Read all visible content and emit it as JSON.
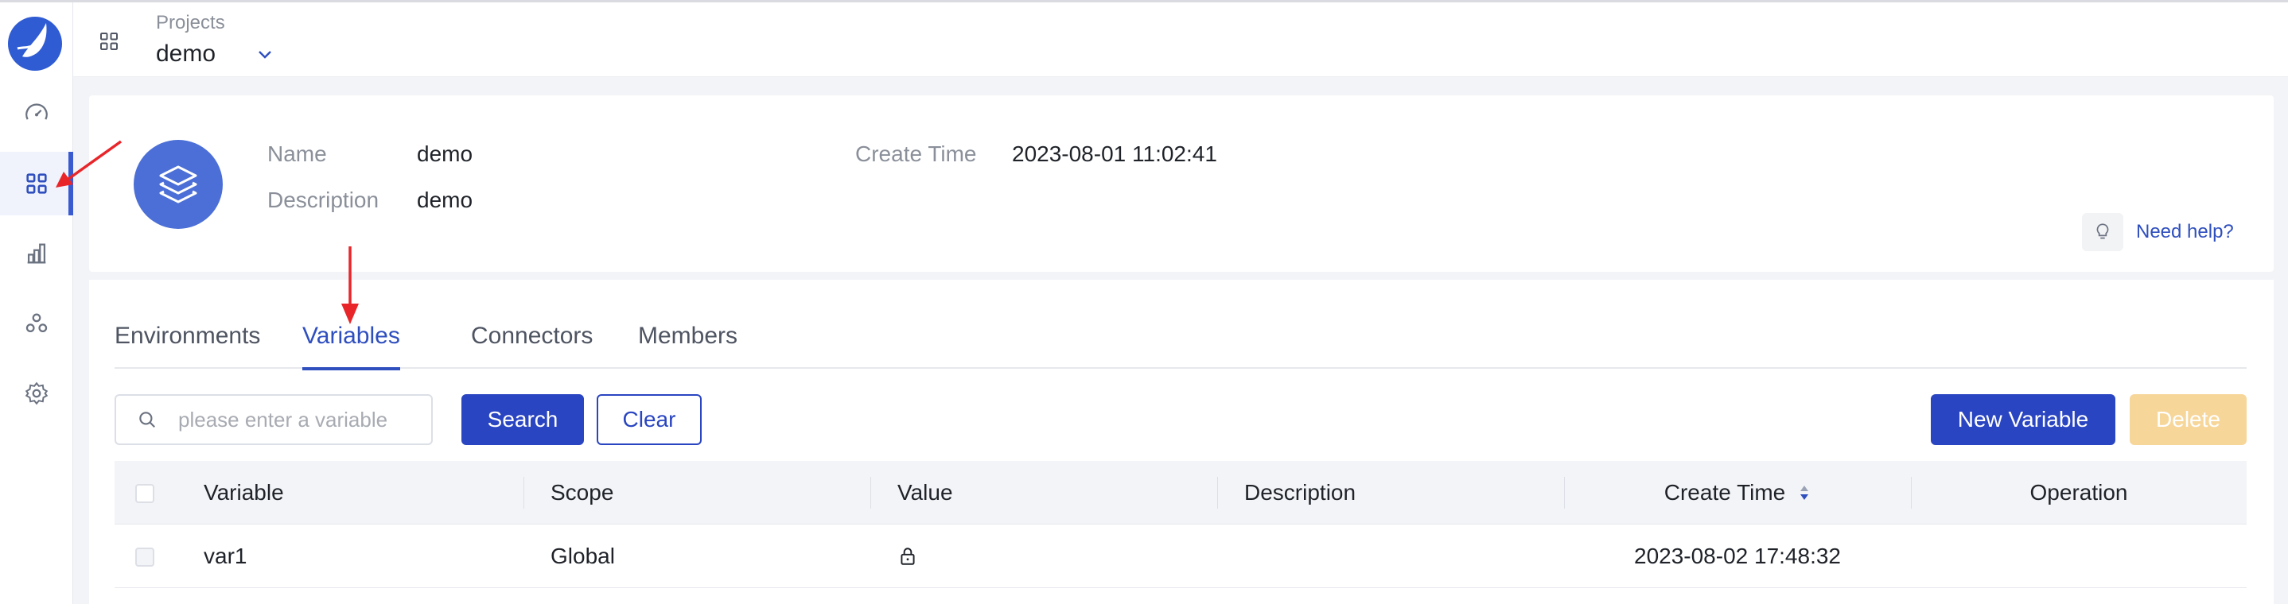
{
  "header": {
    "projects_label": "Projects",
    "project_name": "demo"
  },
  "project_info": {
    "name_label": "Name",
    "name_value": "demo",
    "description_label": "Description",
    "description_value": "demo",
    "create_time_label": "Create Time",
    "create_time_value": "2023-08-01 11:02:41",
    "help_label": "Need help?"
  },
  "tabs": [
    {
      "label": "Environments",
      "active": false
    },
    {
      "label": "Variables",
      "active": true
    },
    {
      "label": "Connectors",
      "active": false
    },
    {
      "label": "Members",
      "active": false
    }
  ],
  "toolbar": {
    "search_placeholder": "please enter a variable",
    "search_value": "",
    "search_button": "Search",
    "clear_button": "Clear",
    "new_button": "New Variable",
    "delete_button": "Delete"
  },
  "table": {
    "columns": [
      "Variable",
      "Scope",
      "Value",
      "Description",
      "Create Time",
      "Operation"
    ],
    "rows": [
      {
        "variable": "var1",
        "scope": "Global",
        "value_icon": "lock-icon",
        "description": "",
        "create_time": "2023-08-02 17:48:32",
        "operation": ""
      }
    ]
  },
  "sidebar": {
    "items": [
      {
        "icon": "dashboard-icon",
        "active": false
      },
      {
        "icon": "projects-grid-icon",
        "active": true
      },
      {
        "icon": "chart-icon",
        "active": false
      },
      {
        "icon": "resources-icon",
        "active": false
      },
      {
        "icon": "settings-icon",
        "active": false
      }
    ]
  },
  "colors": {
    "primary": "#2a45c1",
    "active_tab": "#2f4fbf",
    "delete_disabled": "#f7d69a",
    "annotation_arrow": "#e8262a"
  }
}
